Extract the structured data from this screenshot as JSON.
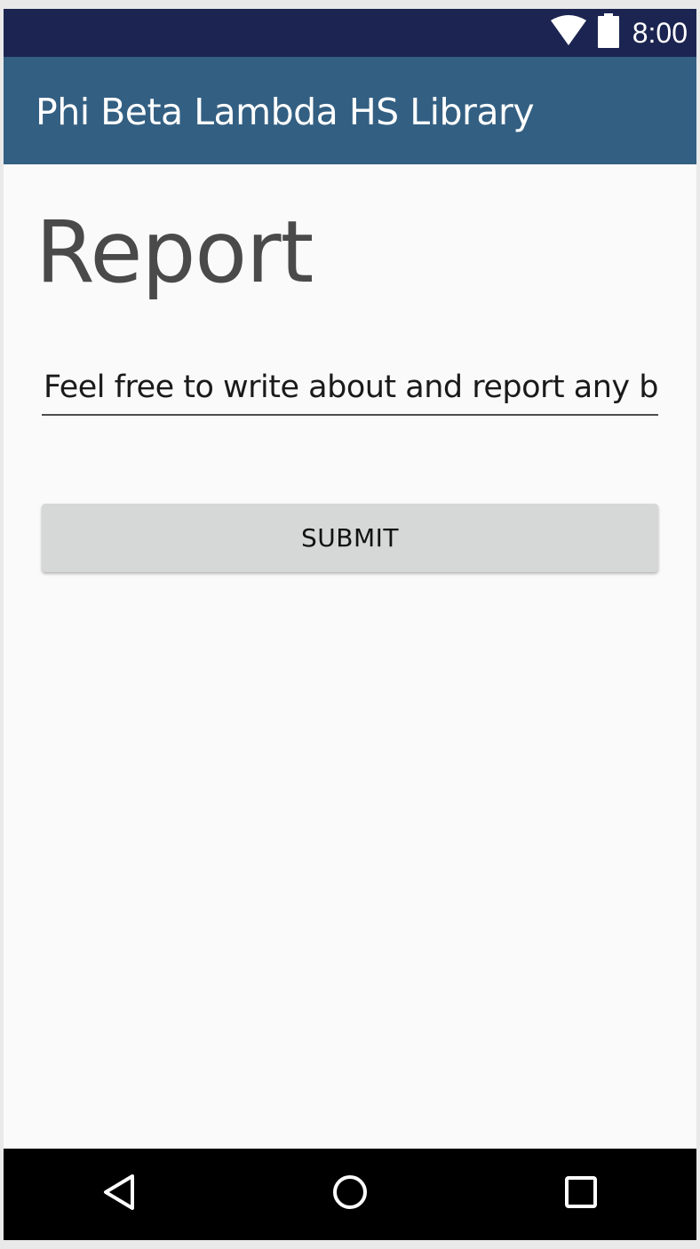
{
  "status_bar": {
    "time": "8:00",
    "icons": [
      "wifi-icon",
      "battery-icon"
    ],
    "background": "#1c2551"
  },
  "app_bar": {
    "title": "Phi Beta Lambda HS Library",
    "background": "#335f82"
  },
  "main": {
    "heading": "Report",
    "report_field": {
      "value": "Feel free to write about and report any bu"
    },
    "submit_label": "SUBMIT"
  },
  "nav_bar": {
    "buttons": [
      "back-icon",
      "home-icon",
      "recents-icon"
    ]
  }
}
